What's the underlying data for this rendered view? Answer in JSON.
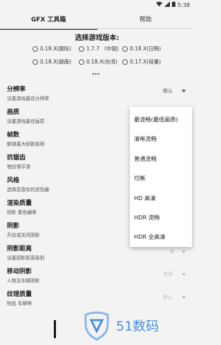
{
  "status": {
    "time": "5:38"
  },
  "tabs": [
    {
      "label": "GFX 工具箱",
      "active": true
    },
    {
      "label": "帮助",
      "active": false
    }
  ],
  "version": {
    "title": "选择游戏版本:",
    "options": [
      "0.18.X(国际)",
      "1.7.7 （中国)",
      "0.18.X(日韩)",
      "0.18.X(越南)",
      "0.18.X(台湾)",
      "0.17.X(轻量)"
    ],
    "more": "..."
  },
  "settings": [
    {
      "title": "分辨率",
      "desc": "设置游戏最佳分辨率",
      "value": "默认"
    },
    {
      "title": "画质",
      "desc": "设置游戏最佳画质",
      "value": ""
    },
    {
      "title": "帧数",
      "desc": "解锁最大帧数极限",
      "value": ""
    },
    {
      "title": "抗锯齿",
      "desc": "使纹理平滑",
      "value": ""
    },
    {
      "title": "风格",
      "desc": "选择您喜欢的滤色器",
      "value": ""
    },
    {
      "title": "渲染质量",
      "desc": "阴影 着色器等",
      "value": ""
    },
    {
      "title": "阴影",
      "desc": "开启或关闭阴影",
      "value": ""
    },
    {
      "title": "阴影距离",
      "desc": "设置阴影距离级别",
      "value": "影"
    },
    {
      "title": "移动阴影",
      "desc": "人物及车辆阴影",
      "value": "关闭"
    },
    {
      "title": "纹理质量",
      "desc": "物品 车辆等",
      "value": "默认"
    }
  ],
  "dropdown": {
    "options": [
      "最流畅(最低画质)",
      "清晰流畅",
      "普通流畅",
      "均衡",
      "HD 高清",
      "HDR 流畅",
      "HDR 全高清"
    ]
  },
  "watermark": {
    "text": "51数码"
  },
  "colors": {
    "accent": "#4d8edc",
    "tab_indicator": "#111111"
  }
}
